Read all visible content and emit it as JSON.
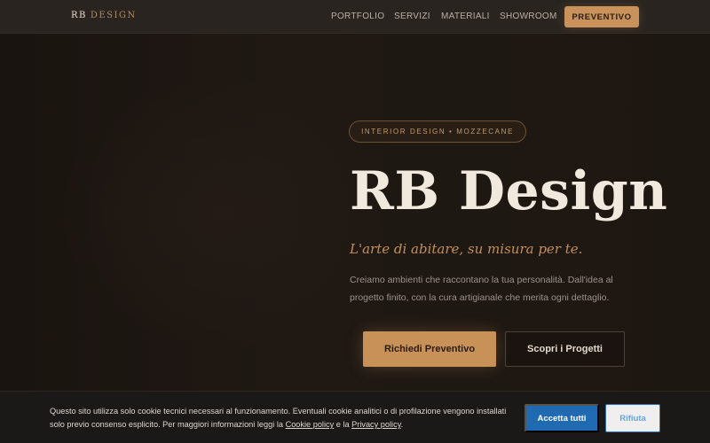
{
  "nav": {
    "logo_rb": "RB",
    "logo_design": "DESIGN",
    "links": [
      "PORTFOLIO",
      "SERVIZI",
      "MATERIALI",
      "SHOWROOM"
    ],
    "cta": "PREVENTIVO"
  },
  "hero": {
    "badge": "INTERIOR DESIGN • MOZZECANE",
    "title": "RB Design",
    "tagline": "L'arte di abitare, su misura per te.",
    "description": "Creiamo ambienti che raccontano la tua personalità. Dall'idea al progetto finito, con la cura artigianale che merita ogni dettaglio.",
    "primary_button": "Richiedi Preventivo",
    "secondary_button": "Scopri i Progetti"
  },
  "cookie": {
    "text_before": "Questo sito utilizza solo cookie tecnici necessari al funzionamento. Eventuali cookie analitici o di profilazione vengono installati solo previo consenso esplicito. Per maggiori informazioni leggi la ",
    "cookie_policy_link": "Cookie policy",
    "text_middle": " e la ",
    "privacy_policy_link": "Privacy policy",
    "text_after": ".",
    "accept_button": "Accetta tutti",
    "reject_button": "Rifiuta"
  },
  "colors": {
    "accent": "#c79158",
    "background": "#1d1713",
    "accept_blue": "#1f6ab1"
  }
}
